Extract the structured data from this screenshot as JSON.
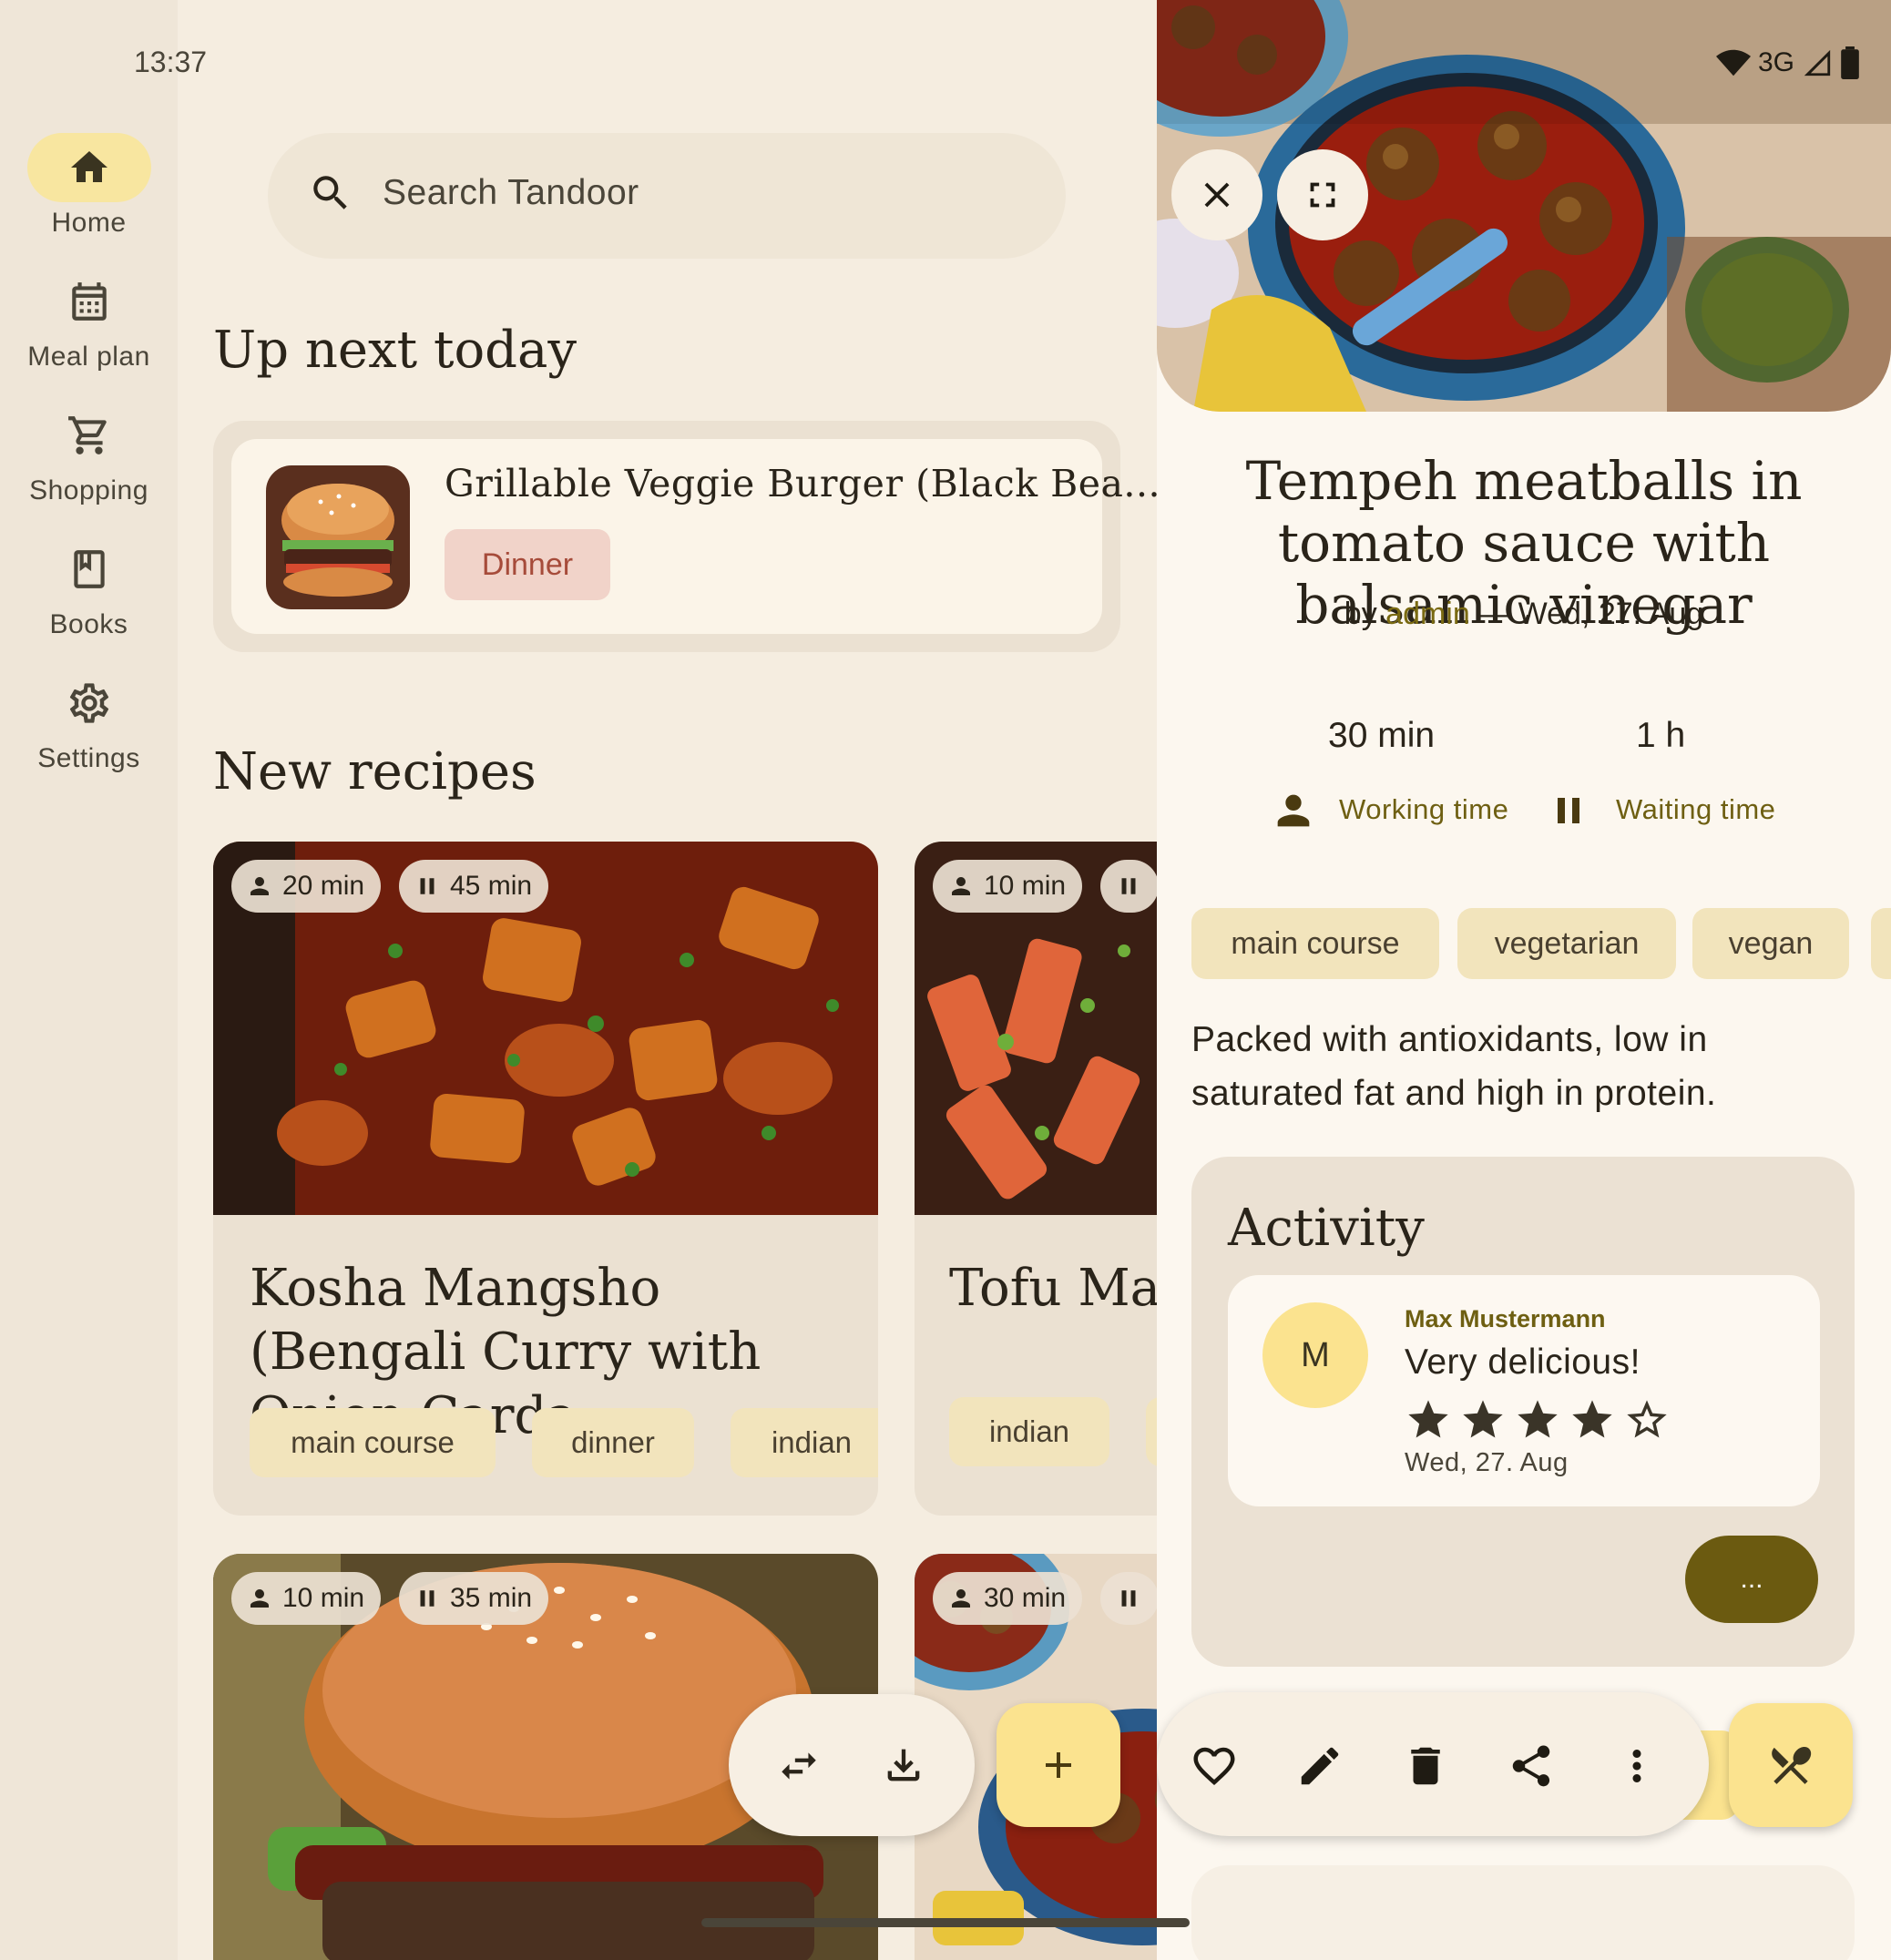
{
  "status_bar": {
    "time": "13:37",
    "network": "3G"
  },
  "nav": {
    "items": [
      {
        "label": "Home",
        "icon": "home-icon",
        "active": true
      },
      {
        "label": "Meal plan",
        "icon": "calendar-icon",
        "active": false
      },
      {
        "label": "Shopping",
        "icon": "cart-icon",
        "active": false
      },
      {
        "label": "Books",
        "icon": "book-icon",
        "active": false
      },
      {
        "label": "Settings",
        "icon": "gear-icon",
        "active": false
      }
    ]
  },
  "search": {
    "placeholder": "Search Tandoor"
  },
  "up_next": {
    "heading": "Up next today",
    "recipe_title": "Grillable Veggie Burger (Black Bea...",
    "meal_type": "Dinner"
  },
  "new_recipes": {
    "heading": "New recipes",
    "cards": [
      {
        "working_time": "20 min",
        "waiting_time": "45 min",
        "title": "Kosha Mangsho (Bengali Curry with Onion Carda...",
        "tags": [
          "main course",
          "dinner",
          "indian"
        ]
      },
      {
        "working_time": "10 min",
        "waiting_time": "",
        "title": "Tofu Man",
        "tags": [
          "indian"
        ]
      },
      {
        "working_time": "10 min",
        "waiting_time": "35 min"
      },
      {
        "working_time": "30 min",
        "waiting_time": ""
      }
    ]
  },
  "detail": {
    "title": "Tempeh meatballs in tomato sauce with balsamic vinegar",
    "by_prefix": "by",
    "author": "admin",
    "date_sep": "—",
    "date": "Wed, 27. Aug",
    "working_time": "30 min",
    "working_label": "Working time",
    "waiting_time": "1 h",
    "waiting_label": "Waiting time",
    "tags": [
      "main course",
      "vegetarian",
      "vegan"
    ],
    "description": "Packed with antioxidants, low in saturated fat and high in protein.",
    "activity": {
      "heading": "Activity",
      "comment": {
        "avatar_initial": "M",
        "user": "Max Mustermann",
        "text": "Very delicious!",
        "rating": 4,
        "rating_max": 5,
        "date": "Wed, 27. Aug"
      },
      "more_label": "..."
    }
  },
  "colors": {
    "background": "#f5ede0",
    "rail": "#efe6d8",
    "accent_yellow": "#fbe38f",
    "tag": "#f2e4bc",
    "dinner_chip": "#f1d3c9",
    "olive": "#6b5a10"
  }
}
